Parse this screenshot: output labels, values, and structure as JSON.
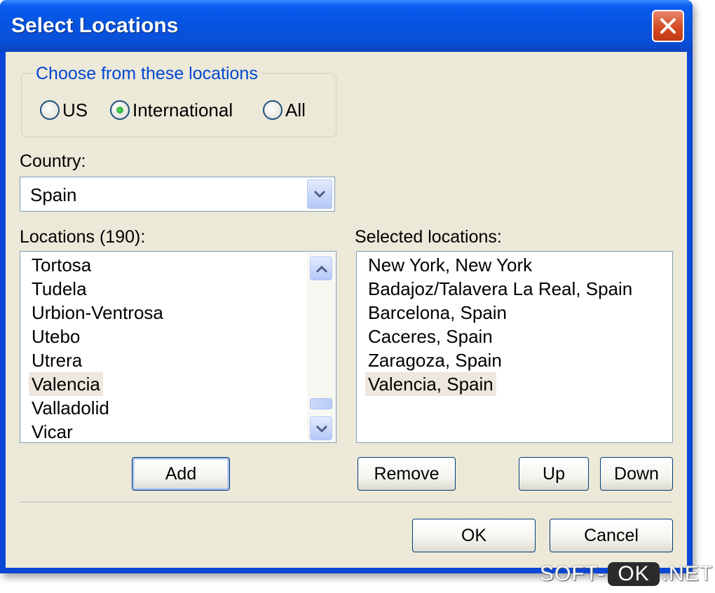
{
  "window": {
    "title": "Select Locations"
  },
  "filter_group": {
    "label": "Choose from these locations",
    "options": [
      {
        "label": "US",
        "selected": false
      },
      {
        "label": "International",
        "selected": true
      },
      {
        "label": "All",
        "selected": false
      }
    ]
  },
  "country": {
    "label": "Country:",
    "value": "Spain"
  },
  "locations": {
    "label": "Locations (190):",
    "items": [
      "Tortosa",
      "Tudela",
      "Urbion-Ventrosa",
      "Utebo",
      "Utrera",
      "Valencia",
      "Valladolid",
      "Vicar"
    ],
    "selected": "Valencia"
  },
  "selected_locations": {
    "label": "Selected locations:",
    "items": [
      "New York, New York",
      "Badajoz/Talavera La Real, Spain",
      "Barcelona, Spain",
      "Caceres, Spain",
      "Zaragoza, Spain",
      "Valencia, Spain"
    ],
    "selected": "Valencia, Spain"
  },
  "buttons": {
    "add": "Add",
    "remove": "Remove",
    "up": "Up",
    "down": "Down",
    "ok": "OK",
    "cancel": "Cancel"
  },
  "watermark": {
    "left": "SOFT-",
    "mid": "OK",
    "right": ".NET"
  }
}
